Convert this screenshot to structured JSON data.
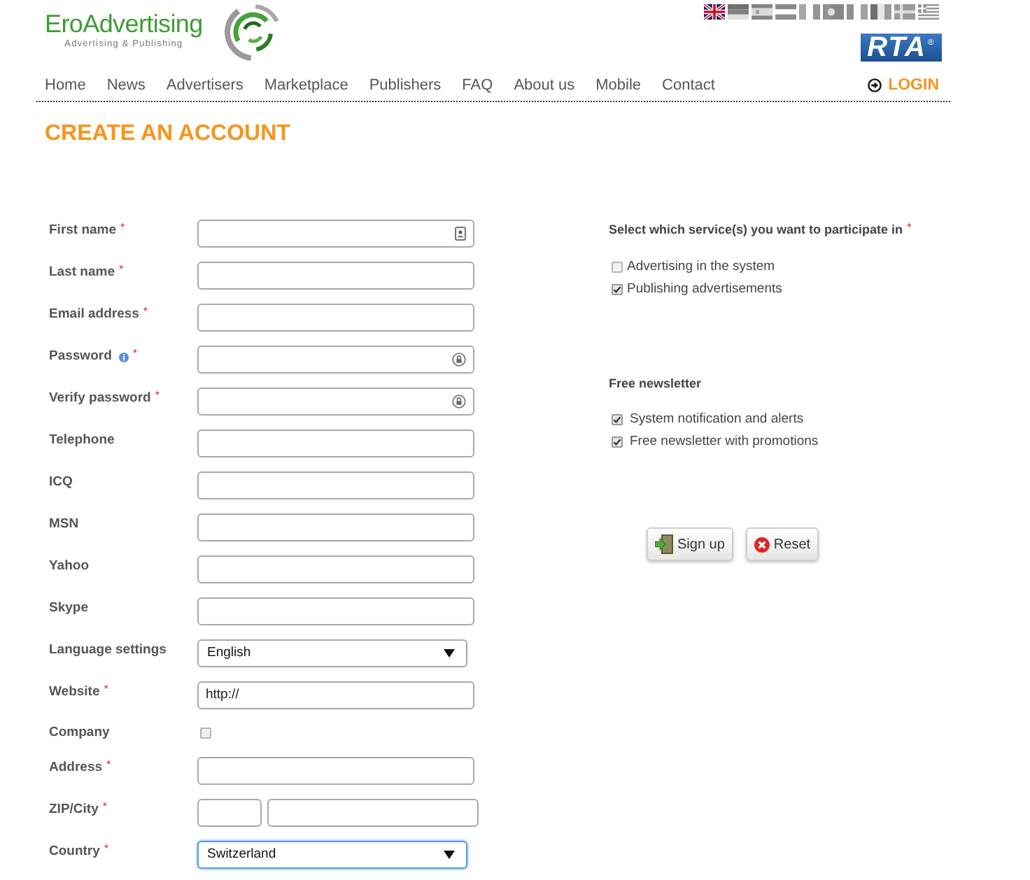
{
  "header": {
    "logo": {
      "name": "EroAdvertising",
      "tagline": "Advertising & Publishing"
    },
    "flags": [
      {
        "selected": true
      },
      {
        "selected": false
      },
      {
        "selected": false
      },
      {
        "selected": false
      },
      {
        "selected": false
      },
      {
        "selected": false
      },
      {
        "selected": false
      },
      {
        "selected": false
      },
      {
        "selected": false
      },
      {
        "selected": false
      }
    ],
    "badge": {
      "text": "RTA",
      "mark": "®"
    }
  },
  "nav": {
    "items": [
      "Home",
      "News",
      "Advertisers",
      "Marketplace",
      "Publishers",
      "FAQ",
      "About us",
      "Mobile",
      "Contact"
    ],
    "login": "LOGIN"
  },
  "page_title": "CREATE AN ACCOUNT",
  "form": {
    "fields": [
      {
        "label": "First name",
        "required_mark": "*",
        "info": false,
        "kind": "text",
        "autofill": true
      },
      {
        "label": "Last name",
        "required_mark": "*",
        "info": false,
        "kind": "text",
        "autofill": false
      },
      {
        "label": "Email address",
        "required_mark": "*",
        "info": false,
        "kind": "text",
        "autofill": false
      },
      {
        "label": "Password",
        "required_mark": "*",
        "info": true,
        "kind": "password"
      },
      {
        "label": "Verify password",
        "required_mark": "*",
        "info": false,
        "kind": "password"
      },
      {
        "label": "Telephone",
        "info": false,
        "kind": "text",
        "autofill": false
      },
      {
        "label": "ICQ",
        "info": false,
        "kind": "text",
        "autofill": false
      },
      {
        "label": "MSN",
        "info": false,
        "kind": "text",
        "autofill": false
      },
      {
        "label": "Yahoo",
        "info": false,
        "kind": "text",
        "autofill": false
      },
      {
        "label": "Skype",
        "info": false,
        "kind": "text",
        "autofill": false
      },
      {
        "label": "Language settings",
        "info": false,
        "kind": "select",
        "value": "English",
        "focused": false
      },
      {
        "label": "Website",
        "required_mark": "*",
        "info": false,
        "kind": "text",
        "value": "http://",
        "autofill": false
      },
      {
        "label": "Company",
        "info": false,
        "kind": "checkbox",
        "checked": false
      },
      {
        "label": "Address",
        "required_mark": "*",
        "info": false,
        "kind": "text",
        "autofill": false
      },
      {
        "label": "ZIP/City",
        "required_mark": "*",
        "info": false,
        "kind": "pair"
      },
      {
        "label": "Country",
        "required_mark": "*",
        "info": false,
        "kind": "select",
        "value": "Switzerland",
        "focused": true
      }
    ]
  },
  "services": {
    "title": "Select which service(s) you want to participate in",
    "required_mark": "*",
    "options": [
      {
        "label": "Advertising in the system",
        "checked": false
      },
      {
        "label": "Publishing advertisements",
        "checked": true
      }
    ]
  },
  "newsletter": {
    "title": "Free newsletter",
    "options": [
      {
        "label": "System notification and alerts",
        "checked": true
      },
      {
        "label": "Free newsletter with promotions",
        "checked": true
      }
    ]
  },
  "buttons": [
    {
      "label": "Sign up",
      "kind": "submit"
    },
    {
      "label": "Reset",
      "kind": "reset"
    }
  ]
}
